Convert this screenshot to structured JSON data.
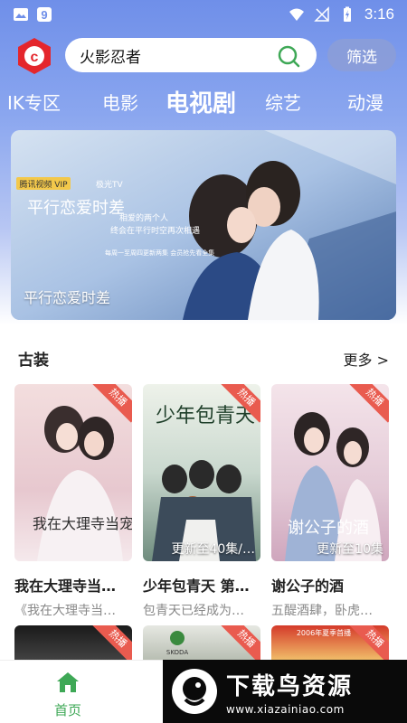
{
  "status_bar": {
    "time": "3:16"
  },
  "header": {
    "search_value": "火影忍者",
    "filter_label": "筛选"
  },
  "tabs": [
    {
      "label": "IK专区",
      "active": false
    },
    {
      "label": "电影",
      "active": false
    },
    {
      "label": "电视剧",
      "active": true
    },
    {
      "label": "综艺",
      "active": false
    },
    {
      "label": "动漫",
      "active": false
    }
  ],
  "banner": {
    "caption": "平行恋爱时差",
    "brand_tags": [
      "腾讯视频 VIP",
      "极光TV"
    ],
    "poster_title": "平行恋爱时差",
    "slogan_line1": "相爱的两个人",
    "slogan_line2": "终会在平行时空再次相遇",
    "schedule": "每周一至周四更新两集 会员抢先看全集"
  },
  "section": {
    "title": "古装",
    "more_label": "更多 >"
  },
  "cards": [
    {
      "title": "我在大理寺当…",
      "desc": "《我在大理寺当…",
      "badge": "热播",
      "update": "",
      "poster_title": "我在大理寺当宠物",
      "colors": [
        "#f3dede",
        "#e7c8cf",
        "#cfa8b5"
      ]
    },
    {
      "title": "少年包青天 第…",
      "desc": "包青天已经成为…",
      "badge": "热播",
      "update": "更新至40集/…",
      "poster_title": "少年包青天",
      "colors": [
        "#dfe9e3",
        "#a9c2b4",
        "#5d7c70"
      ]
    },
    {
      "title": "谢公子的酒",
      "desc": "五醍酒肆，卧虎…",
      "badge": "热播",
      "update": "更新至10集",
      "poster_title": "谢公子的酒",
      "colors": [
        "#f4e4ea",
        "#dec2d0",
        "#b993ab"
      ]
    }
  ],
  "row2_cards": [
    {
      "badge": "热播",
      "colors": [
        "#1a1a1a",
        "#444"
      ]
    },
    {
      "badge": "热播",
      "colors": [
        "#e6e8e2",
        "#b6bcb0"
      ]
    },
    {
      "badge": "热播",
      "colors": [
        "#d43a2a",
        "#f2c36c"
      ]
    }
  ],
  "row2_poster_texts": {
    "brand": "SKODA",
    "year_banner": "2006年夏季首播"
  },
  "bottom_nav": {
    "home_label": "首页"
  },
  "watermark": {
    "title": "下载鸟资源",
    "url": "www.xiazainiao.com"
  },
  "colors": {
    "accent_green": "#3ea856",
    "badge_red": "#e95b4f",
    "header_blue": "#6f8fe9"
  }
}
